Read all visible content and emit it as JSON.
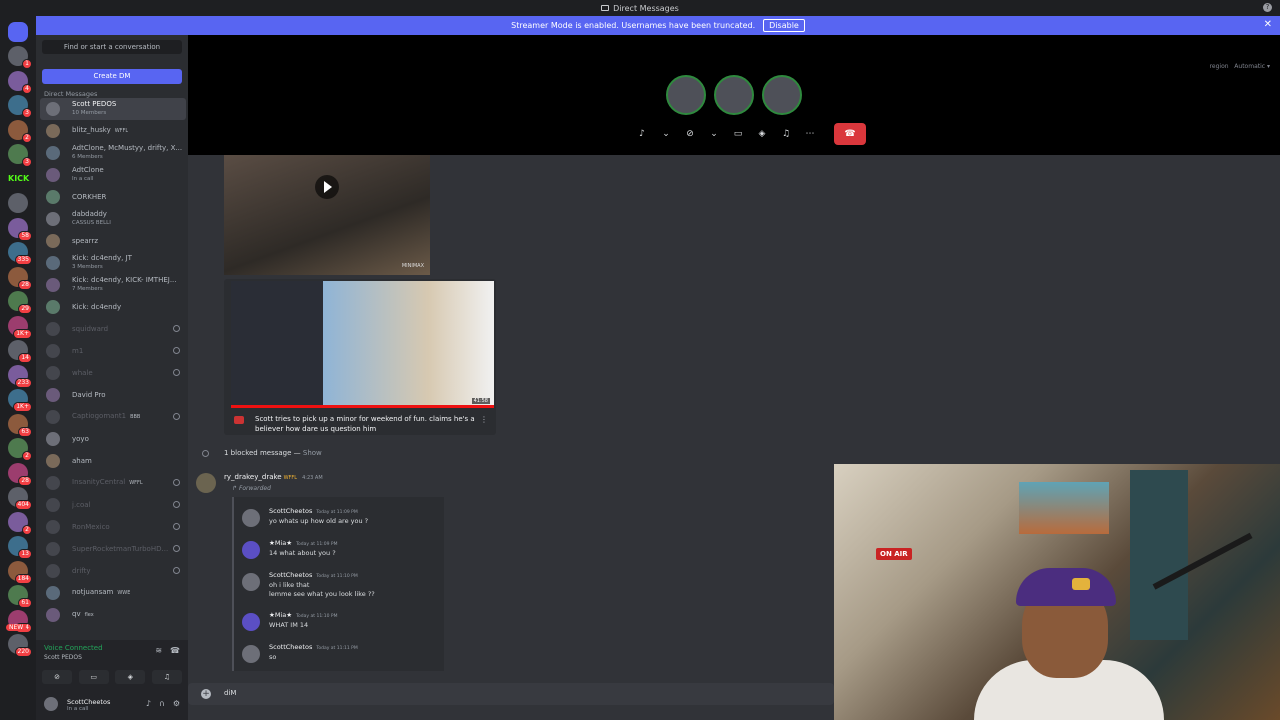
{
  "titlebar": {
    "title": "Direct Messages"
  },
  "banner": {
    "text": "Streamer Mode is enabled. Usernames have been truncated.",
    "disable_label": "Disable"
  },
  "servers": [
    {
      "badge": "1"
    },
    {
      "badge": "4"
    },
    {
      "badge": "3"
    },
    {
      "badge": "2"
    },
    {
      "badge": "3"
    },
    {
      "badge": ""
    },
    {
      "badge": ""
    },
    {
      "badge": "58"
    },
    {
      "badge": "335"
    },
    {
      "badge": "28"
    },
    {
      "badge": "29"
    },
    {
      "badge": "1K+"
    },
    {
      "badge": "14"
    },
    {
      "badge": "233"
    },
    {
      "badge": "1K+"
    },
    {
      "badge": "63"
    },
    {
      "badge": "2"
    },
    {
      "badge": "28"
    },
    {
      "badge": "404"
    },
    {
      "badge": "2"
    },
    {
      "badge": "13"
    },
    {
      "badge": "184"
    },
    {
      "badge": "61"
    },
    {
      "badge": "124"
    },
    {
      "badge": "220"
    }
  ],
  "rail": {
    "kick_label": "KICK",
    "new_label": "NEW"
  },
  "sidebar": {
    "search_placeholder": "Find or start a conversation",
    "create_dm": "Create DM",
    "header": "Direct Messages",
    "dms": [
      {
        "name": "Scott PEDOS",
        "sub": "10 Members",
        "tag": "",
        "muted": false,
        "blocked": false,
        "active": true
      },
      {
        "name": "blitz_husky",
        "sub": "",
        "tag": "WFFL",
        "muted": false,
        "blocked": false,
        "active": false
      },
      {
        "name": "AdtClone, McMustyy, drifty, X...",
        "sub": "6 Members",
        "tag": "",
        "muted": false,
        "blocked": false,
        "active": false
      },
      {
        "name": "AdtClone",
        "sub": "In a call",
        "tag": "",
        "muted": false,
        "blocked": false,
        "active": false
      },
      {
        "name": "CORKHER",
        "sub": "",
        "tag": "",
        "muted": false,
        "blocked": false,
        "active": false
      },
      {
        "name": "dabdaddy",
        "sub": "CASSUS BELLI",
        "tag": "",
        "muted": false,
        "blocked": false,
        "active": false
      },
      {
        "name": "spearrz",
        "sub": "",
        "tag": "",
        "muted": false,
        "blocked": false,
        "active": false
      },
      {
        "name": "Kick: dc4endy, JT",
        "sub": "3 Members",
        "tag": "",
        "muted": false,
        "blocked": false,
        "active": false
      },
      {
        "name": "Kick: dc4endy, KICK- IMTHEJ...",
        "sub": "7 Members",
        "tag": "",
        "muted": false,
        "blocked": false,
        "active": false
      },
      {
        "name": "Kick: dc4endy",
        "sub": "",
        "tag": "",
        "muted": false,
        "blocked": false,
        "active": false
      },
      {
        "name": "squidward",
        "sub": "",
        "tag": "",
        "muted": true,
        "blocked": true,
        "active": false
      },
      {
        "name": "m1",
        "sub": "",
        "tag": "",
        "muted": true,
        "blocked": true,
        "active": false
      },
      {
        "name": "whale",
        "sub": "",
        "tag": "",
        "muted": true,
        "blocked": true,
        "active": false
      },
      {
        "name": "David Pro",
        "sub": "",
        "tag": "",
        "muted": false,
        "blocked": false,
        "active": false
      },
      {
        "name": "Captiogomant1",
        "sub": "",
        "tag": "BBB",
        "muted": true,
        "blocked": true,
        "active": false
      },
      {
        "name": "yoyo",
        "sub": "",
        "tag": "",
        "muted": false,
        "blocked": false,
        "active": false
      },
      {
        "name": "aham",
        "sub": "",
        "tag": "",
        "muted": false,
        "blocked": false,
        "active": false
      },
      {
        "name": "InsanityCentral",
        "sub": "",
        "tag": "WFFL",
        "muted": true,
        "blocked": true,
        "active": false
      },
      {
        "name": "j.coal",
        "sub": "",
        "tag": "",
        "muted": true,
        "blocked": true,
        "active": false
      },
      {
        "name": "RonMexico",
        "sub": "",
        "tag": "",
        "muted": true,
        "blocked": true,
        "active": false
      },
      {
        "name": "SuperRocketmanTurboHD...",
        "sub": "",
        "tag": "",
        "muted": true,
        "blocked": true,
        "active": false
      },
      {
        "name": "drifty",
        "sub": "",
        "tag": "",
        "muted": true,
        "blocked": true,
        "active": false
      },
      {
        "name": "notjuansam",
        "sub": "",
        "tag": "WWE",
        "muted": false,
        "blocked": false,
        "active": false
      },
      {
        "name": "qv",
        "sub": "",
        "tag": "flex",
        "muted": false,
        "blocked": false,
        "active": false
      }
    ]
  },
  "voice": {
    "title": "Voice Connected",
    "channel": "Scott PEDOS"
  },
  "user": {
    "name": "ScottCheetos",
    "status": "In a call"
  },
  "call": {
    "region_label": "region",
    "region_value": "Automatic"
  },
  "chat": {
    "video1_watermark": "MINIMAX",
    "video2_duration": "41:58",
    "embed_title": "Scott tries to pick up a minor for weekend of fun. claims he's a believer how dare us question him",
    "blocked_text": "1 blocked message — ",
    "blocked_show": "Show",
    "author": "ry_drakey_drake",
    "author_tag": "WFFL",
    "author_time": "4:23 AM",
    "forwarded_label": "Forwarded",
    "forwarded": [
      {
        "name": "ScottCheetos",
        "time": "Today at 11:09 PM",
        "lines": [
          "yo whats up how old are you ?"
        ],
        "mia": false
      },
      {
        "name": "★Mia★",
        "time": "Today at 11:09 PM",
        "lines": [
          "14 what about you ?"
        ],
        "mia": true
      },
      {
        "name": "ScottCheetos",
        "time": "Today at 11:10 PM",
        "lines": [
          "oh i like that",
          "lemme see what you look like ??"
        ],
        "mia": false
      },
      {
        "name": "★Mia★",
        "time": "Today at 11:10 PM",
        "lines": [
          "WHAT IM 14"
        ],
        "mia": true
      },
      {
        "name": "ScottCheetos",
        "time": "Today at 11:11 PM",
        "lines": [
          "so"
        ],
        "mia": false
      }
    ],
    "composer_text": "diM"
  },
  "webcam": {
    "sign": "ON AIR"
  }
}
